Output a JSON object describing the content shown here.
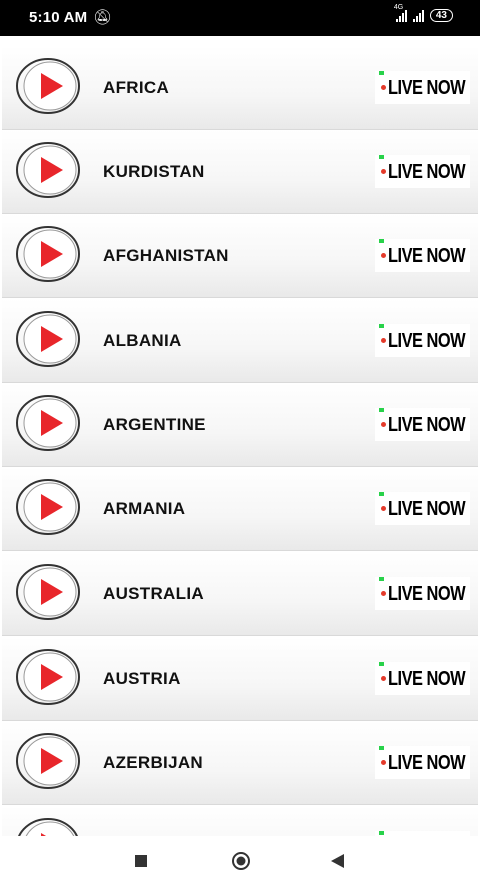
{
  "status_bar": {
    "time": "5:10 AM",
    "network_label": "4G",
    "battery": "43",
    "icons": [
      "notification-off-icon",
      "signal-4g-icon",
      "signal-icon",
      "battery-icon"
    ]
  },
  "list": {
    "items": [
      {
        "label": "AFRICA",
        "badge": "LIVE NOW"
      },
      {
        "label": "KURDISTAN",
        "badge": "LIVE NOW"
      },
      {
        "label": "AFGHANISTAN",
        "badge": "LIVE NOW"
      },
      {
        "label": "ALBANIA",
        "badge": "LIVE NOW"
      },
      {
        "label": "ARGENTINE",
        "badge": "LIVE NOW"
      },
      {
        "label": "ARMANIA",
        "badge": "LIVE NOW"
      },
      {
        "label": "AUSTRALIA",
        "badge": "LIVE NOW"
      },
      {
        "label": "AUSTRIA",
        "badge": "LIVE NOW"
      },
      {
        "label": "AZERBIJAN",
        "badge": "LIVE NOW"
      },
      {
        "label": "",
        "badge": ""
      }
    ]
  },
  "colors": {
    "play_red": "#e8262b",
    "live_dot": "#e43a2a",
    "live_green": "#28d24a",
    "status_bar": "#000000"
  },
  "nav_bar": {
    "icons": [
      "recent-apps-icon",
      "home-icon",
      "back-icon"
    ]
  }
}
